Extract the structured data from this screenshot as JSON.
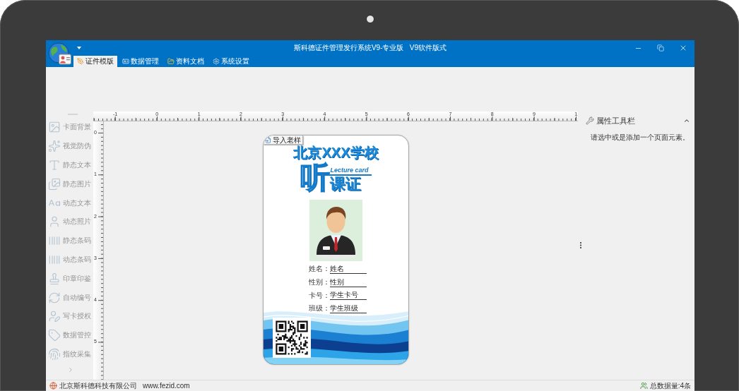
{
  "window": {
    "title": "斯科德证件管理发行系统V9-专业版   V9软件版式"
  },
  "ribbon_tabs": [
    {
      "label": "证件模版",
      "selected": true
    },
    {
      "label": "数据管理",
      "selected": false
    },
    {
      "label": "资料文档",
      "selected": false
    },
    {
      "label": "系统设置",
      "selected": false
    }
  ],
  "sidebar": {
    "items": [
      {
        "label": "卡面背景",
        "disabled": true
      },
      {
        "label": "视觉防伪",
        "disabled": true
      },
      {
        "label": "静态文本",
        "disabled": true
      },
      {
        "label": "静态图片",
        "disabled": true
      },
      {
        "label": "动态文本",
        "disabled": true
      },
      {
        "label": "动态照片",
        "disabled": true
      },
      {
        "label": "静态条码",
        "disabled": true
      },
      {
        "label": "动态条码",
        "disabled": true
      },
      {
        "label": "印章印鉴",
        "disabled": true
      },
      {
        "label": "自动编号",
        "disabled": true
      },
      {
        "label": "写卡授权",
        "disabled": true
      },
      {
        "label": "数据管控",
        "disabled": true
      },
      {
        "label": "指纹采集",
        "disabled": true
      }
    ]
  },
  "rulers": {
    "horizontal": [
      "-1",
      "0",
      "1",
      "2",
      "3",
      "4",
      "5",
      "6",
      "7",
      "8",
      "9",
      "1"
    ],
    "vertical": [
      "0",
      "1",
      "2",
      "3",
      "4",
      "5"
    ]
  },
  "card": {
    "import_button": "导入老样",
    "school_name": "北京XXX学校",
    "logo": {
      "character": "听",
      "subtitle": "Lecture card",
      "text": "课证"
    },
    "fields": [
      {
        "label": "姓名：",
        "value": "姓名"
      },
      {
        "label": "性别：",
        "value": "性别"
      },
      {
        "label": "卡号：",
        "value": "学生卡号"
      },
      {
        "label": "班级：",
        "value": "学生班级"
      }
    ]
  },
  "properties_panel": {
    "title": "属性工具栏",
    "expanded": true,
    "hint": "请选中或是添加一个页面元素。"
  },
  "status_bar": {
    "company": "北京斯科德科技有限公司",
    "website": "www.fezid.com",
    "total": "总数据量:4条"
  }
}
